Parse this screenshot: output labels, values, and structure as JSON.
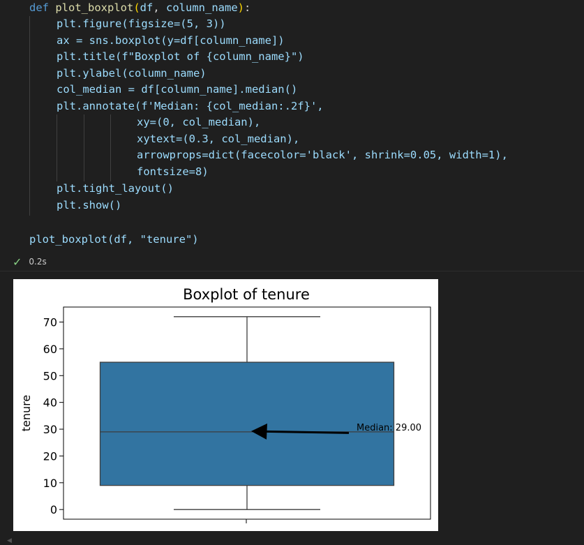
{
  "code": {
    "def_kw": "def",
    "func_name": "plot_boxplot",
    "params": [
      "df",
      "column_name"
    ],
    "lines": {
      "figure": "plt.figure(figsize=(5, 3))",
      "boxplot": "ax = sns.boxplot(y=df[column_name])",
      "title": "plt.title(f\"Boxplot of {column_name}\")",
      "ylabel": "plt.ylabel(column_name)",
      "median": "col_median = df[column_name].median()",
      "annotate1": "plt.annotate(f'Median: {col_median:.2f}',",
      "annotate2": "xy=(0, col_median),",
      "annotate3": "xytext=(0.3, col_median),",
      "annotate4": "arrowprops=dict(facecolor='black', shrink=0.05, width=1),",
      "annotate5": "fontsize=8)",
      "tight": "plt.tight_layout()",
      "show": "plt.show()",
      "call": "plot_boxplot(df, \"tenure\")"
    }
  },
  "status": {
    "icon": "check-icon",
    "time": "0.2s"
  },
  "chart_data": {
    "type": "boxplot",
    "title": "Boxplot of tenure",
    "ylabel": "tenure",
    "xlabel": "",
    "ylim": [
      -3.6,
      75.6
    ],
    "yticks": [
      0,
      10,
      20,
      30,
      40,
      50,
      60,
      70
    ],
    "series": [
      {
        "min": 0,
        "q1": 9,
        "median": 29,
        "q3": 55,
        "max": 72
      }
    ],
    "box_color": "#3274a1",
    "annotation": {
      "text": "Median: 29.00",
      "arrow_from_x": 0.3,
      "arrow_to_x": 0,
      "y": 29
    },
    "grid": false
  }
}
